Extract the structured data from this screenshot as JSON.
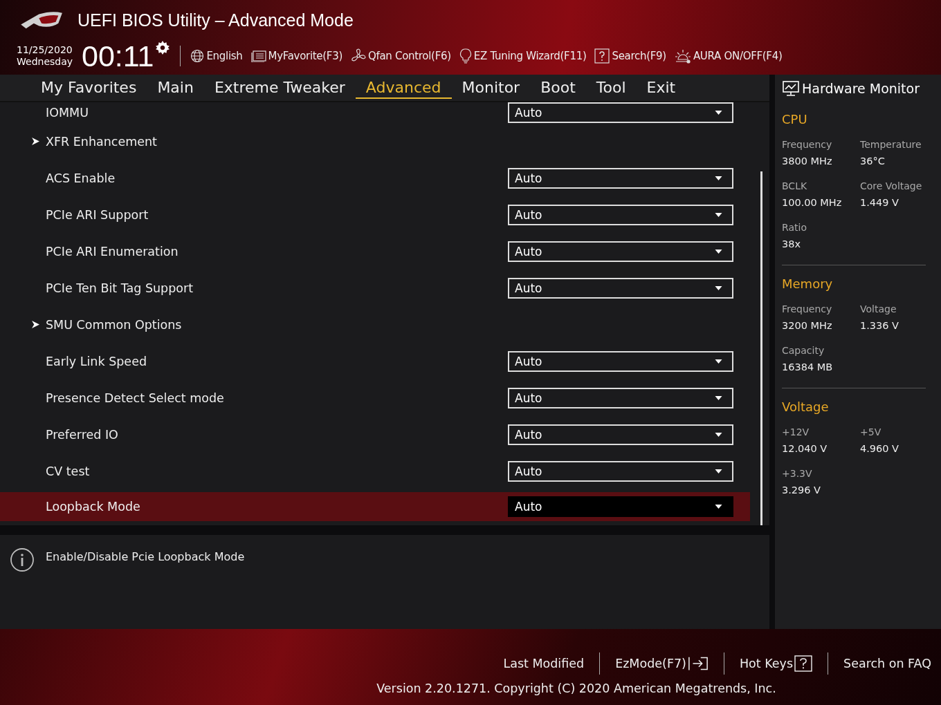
{
  "header": {
    "title": "UEFI BIOS Utility – Advanced Mode",
    "date": "11/25/2020",
    "day": "Wednesday",
    "time": "00:11",
    "toolbar": [
      {
        "label": "English",
        "kind": "globe"
      },
      {
        "label": "MyFavorite(F3)",
        "kind": "list"
      },
      {
        "label": "Qfan Control(F6)",
        "kind": "fan"
      },
      {
        "label": "EZ Tuning Wizard(F11)",
        "kind": "bulb"
      },
      {
        "label": "Search(F9)",
        "kind": "help"
      },
      {
        "label": "AURA ON/OFF(F4)",
        "kind": "aura"
      }
    ]
  },
  "tabs": [
    {
      "label": "My Favorites",
      "selected": false
    },
    {
      "label": "Main",
      "selected": false
    },
    {
      "label": "Extreme Tweaker",
      "selected": false
    },
    {
      "label": "Advanced",
      "selected": true
    },
    {
      "label": "Monitor",
      "selected": false
    },
    {
      "label": "Boot",
      "selected": false
    },
    {
      "label": "Tool",
      "selected": false
    },
    {
      "label": "Exit",
      "selected": false
    }
  ],
  "settings": [
    {
      "label": "IOMMU",
      "kind": "setting",
      "value": "Auto",
      "selected": false
    },
    {
      "label": "XFR Enhancement",
      "kind": "submenu",
      "selected": false
    },
    {
      "label": "ACS Enable",
      "kind": "setting",
      "value": "Auto",
      "selected": false
    },
    {
      "label": "PCIe ARI Support",
      "kind": "setting",
      "value": "Auto",
      "selected": false
    },
    {
      "label": "PCIe ARI Enumeration",
      "kind": "setting",
      "value": "Auto",
      "selected": false
    },
    {
      "label": "PCIe Ten Bit Tag Support",
      "kind": "setting",
      "value": "Auto",
      "selected": false
    },
    {
      "label": "SMU Common Options",
      "kind": "submenu",
      "selected": false
    },
    {
      "label": "Early Link Speed",
      "kind": "setting",
      "value": "Auto",
      "selected": false
    },
    {
      "label": "Presence Detect Select mode",
      "kind": "setting",
      "value": "Auto",
      "selected": false
    },
    {
      "label": "Preferred IO",
      "kind": "setting",
      "value": "Auto",
      "selected": false
    },
    {
      "label": "CV test",
      "kind": "setting",
      "value": "Auto",
      "selected": false
    },
    {
      "label": "Loopback Mode",
      "kind": "setting",
      "value": "Auto",
      "selected": true
    }
  ],
  "help": "Enable/Disable Pcie Loopback Mode",
  "hardware_monitor": {
    "title": "Hardware Monitor",
    "sections": [
      {
        "title": "CPU",
        "fields": [
          {
            "label": "Frequency",
            "value": "3800 MHz"
          },
          {
            "label": "Temperature",
            "value": "36°C"
          },
          {
            "label": "BCLK",
            "value": "100.00 MHz"
          },
          {
            "label": "Core Voltage",
            "value": "1.449 V"
          },
          {
            "label": "Ratio",
            "value": "38x"
          }
        ]
      },
      {
        "title": "Memory",
        "fields": [
          {
            "label": "Frequency",
            "value": "3200 MHz"
          },
          {
            "label": "Voltage",
            "value": "1.336 V"
          },
          {
            "label": "Capacity",
            "value": "16384 MB"
          }
        ]
      },
      {
        "title": "Voltage",
        "fields": [
          {
            "label": "+12V",
            "value": "12.040 V"
          },
          {
            "label": "+5V",
            "value": "4.960 V"
          },
          {
            "label": "+3.3V",
            "value": "3.296 V"
          }
        ]
      }
    ]
  },
  "footer": {
    "links": [
      {
        "label": "Last Modified",
        "kind": "text"
      },
      {
        "label": "EzMode(F7)",
        "kind": "exit"
      },
      {
        "label": "Hot Keys",
        "kind": "help"
      },
      {
        "label": "Search on FAQ",
        "kind": "text"
      }
    ],
    "version": "Version 2.20.1271. Copyright (C) 2020 American Megatrends, Inc."
  }
}
